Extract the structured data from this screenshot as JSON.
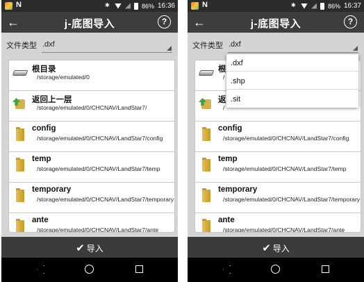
{
  "screens": [
    {
      "status": {
        "battery_text": "86%",
        "time": "16:36"
      },
      "title": "j-底图导入",
      "filetype": {
        "label": "文件类型",
        "value": ".dxf"
      },
      "rows": [
        {
          "icon": "drive-icon",
          "title": "根目录",
          "path": "/storage/emulated/0"
        },
        {
          "icon": "folder-up-icon",
          "title": "返回上一层",
          "path": "/storage/emulated/0/CHCNAV/LandStar7/"
        },
        {
          "icon": "folder-icon",
          "title": "config",
          "path": "/storage/emulated/0/CHCNAV/LandStar7/config"
        },
        {
          "icon": "folder-icon",
          "title": "temp",
          "path": "/storage/emulated/0/CHCNAV/LandStar7/temp"
        },
        {
          "icon": "folder-icon",
          "title": "temporary",
          "path": "/storage/emulated/0/CHCNAV/LandStar7/temporary"
        },
        {
          "icon": "folder-icon",
          "title": "ante",
          "path": "/storage/emulated/0/CHCNAV/LandStar7/ante"
        }
      ],
      "import_label": "导入"
    },
    {
      "status": {
        "battery_text": "86%",
        "time": "16:37"
      },
      "title": "j-底图导入",
      "filetype": {
        "label": "文件类型",
        "value": ".dxf"
      },
      "rows": [
        {
          "icon": "drive-icon",
          "title": "根",
          "path": "/"
        },
        {
          "icon": "folder-up-icon",
          "title": "返",
          "path": "/"
        },
        {
          "icon": "folder-icon",
          "title": "config",
          "path": "/storage/emulated/0/CHCNAV/LandStar7/config"
        },
        {
          "icon": "folder-icon",
          "title": "temp",
          "path": "/storage/emulated/0/CHCNAV/LandStar7/temp"
        },
        {
          "icon": "folder-icon",
          "title": "temporary",
          "path": "/storage/emulated/0/CHCNAV/LandStar7/temporary"
        },
        {
          "icon": "folder-icon",
          "title": "ante",
          "path": "/storage/emulated/0/CHCNAV/LandStar7/ante"
        }
      ],
      "dropdown_options": [
        ".dxf",
        ".shp",
        ".sit"
      ],
      "import_label": "导入"
    }
  ]
}
